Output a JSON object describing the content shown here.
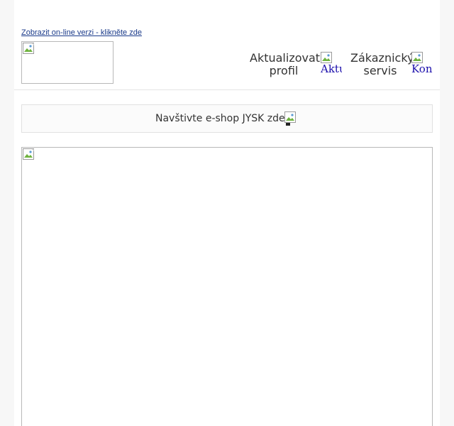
{
  "header": {
    "online_link": "Zobrazit on-line verzi - klikněte zde",
    "nav": {
      "profile_label": "Aktualizovat profil",
      "profile_img_alt": "Aktu",
      "service_label": "Zákaznický servis",
      "service_img_alt": "Kont"
    }
  },
  "eshop": {
    "label": "Navštivte e-shop JYSK zde"
  },
  "icons": {
    "broken_image": "broken-image-icon"
  },
  "colors": {
    "link": "#1a3a8a",
    "alt_text": "#1a0dab",
    "text": "#333333",
    "page_bg": "#ffffff",
    "outer_bg": "#f7f7f7"
  }
}
